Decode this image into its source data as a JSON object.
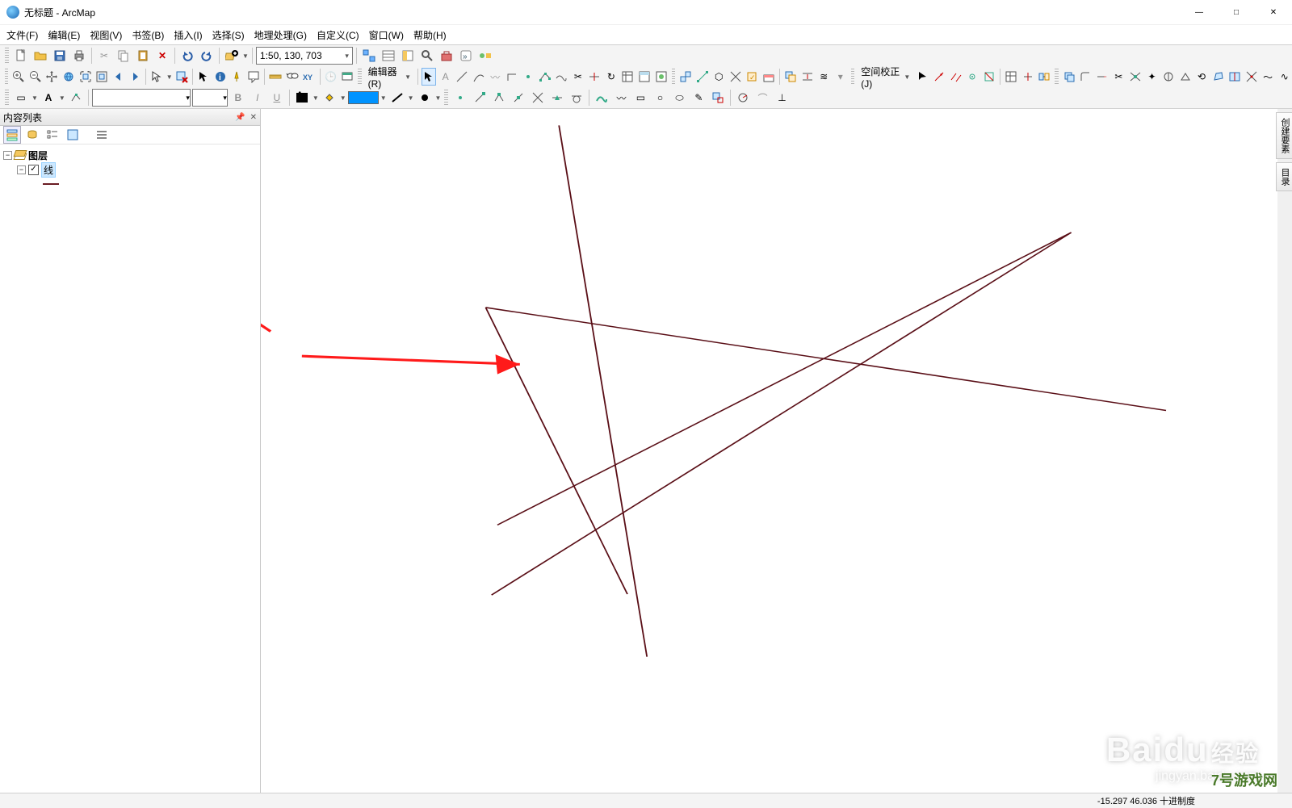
{
  "window": {
    "title": "无标题 - ArcMap"
  },
  "menu": {
    "file": "文件(F)",
    "edit": "编辑(E)",
    "view": "视图(V)",
    "bookmarks": "书签(B)",
    "insert": "插入(I)",
    "selection": "选择(S)",
    "geoprocessing": "地理处理(G)",
    "customize": "自定义(C)",
    "window": "窗口(W)",
    "help": "帮助(H)"
  },
  "toolbar": {
    "scale": "1:50, 130, 703",
    "editor_label": "编辑器(R)",
    "spatial_adjust_label": "空间校正(J)"
  },
  "toc": {
    "title": "内容列表",
    "root_label": "图层",
    "layer1_label": "线"
  },
  "side_tabs": {
    "create": "创建要素",
    "catalog": "目录"
  },
  "status": {
    "coords": "-15.297  46.036  十进制度"
  },
  "watermark": {
    "brand": "Baidu",
    "sub": "经验",
    "url": "jingyan.baidu.com"
  },
  "logo2": {
    "text": "7号游戏网"
  },
  "colors": {
    "feature_line": "#5a0f17",
    "annotation": "#ff1a1a",
    "swatch": "#0093ff"
  }
}
